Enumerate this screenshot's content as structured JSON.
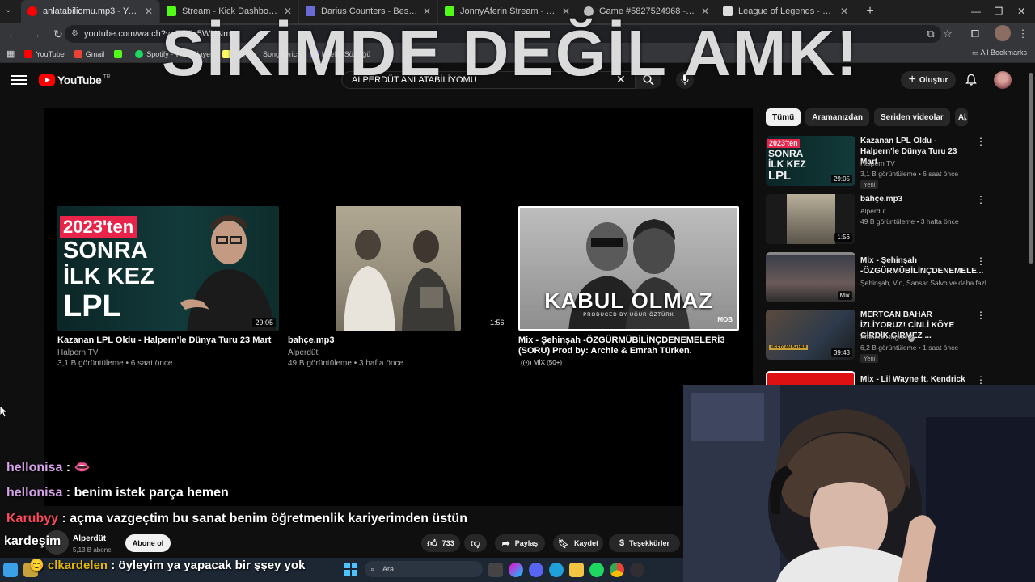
{
  "tabs": [
    {
      "title": "anlatabiliomu.mp3 - YouTube",
      "color": "#ff0000",
      "active": true
    },
    {
      "title": "Stream - Kick Dashboard",
      "color": "#53fc18",
      "active": false
    },
    {
      "title": "Darius Counters - Best & Worst",
      "color": "#6b6bd6",
      "active": false
    },
    {
      "title": "JonnyAferin Stream - Watch Live",
      "color": "#53fc18",
      "active": false
    },
    {
      "title": "Game #5827524968 - Mineswe",
      "color": "#bbbbbb",
      "active": false
    },
    {
      "title": "League of Legends - Speedrun",
      "color": "#dddddd",
      "active": false
    }
  ],
  "address": {
    "url": "youtube.com/watch?v=BGIiv5WUNmg"
  },
  "bookmarks": [
    {
      "label": "YouTube",
      "color": "#ff0000"
    },
    {
      "label": "Gmail",
      "color": "#ea4335"
    },
    {
      "label": "",
      "color": "#53fc18"
    },
    {
      "label": "Spotify - Web Player",
      "color": "#1ed760"
    },
    {
      "label": "Genius | Song Lyrics",
      "color": "#ffff64"
    },
    {
      "label": "Hileler Sözlüğü",
      "color": "#7b68ee"
    }
  ],
  "all_bookmarks": "All Bookmarks",
  "youtube": {
    "logo": "YouTube",
    "region": "TR",
    "search_value": "ALPERDÜT ANLATABİLİYOMU",
    "create": "Oluştur"
  },
  "overlay": "SİKİMDE DEĞİL AMK!",
  "endcards": [
    {
      "title": "Kazanan LPL Oldu - Halpern'le Dünya Turu 23 Mart",
      "channel": "Halpern TV",
      "meta": "3,1 B görüntüleme • 6 saat önce",
      "duration": "29:05",
      "thumb_lines": [
        "2023'ten",
        "SONRA",
        "İLK KEZ",
        "LPL"
      ]
    },
    {
      "title": "bahçe.mp3",
      "channel": "Alperdüt",
      "meta": "49 B görüntüleme • 3 hafta önce",
      "duration": "1:56"
    },
    {
      "title": "Mix - Şehinşah -ÖZGÜRMÜBİLİNÇDENEMELERİ3 (SORU) Prod by: Archie & Emrah Türken.",
      "channel": "MİX (50+)",
      "thumb_text": "KABUL OLMAZ",
      "thumb_sub": "PRODUCED BY UĞUR ÖZTÜRK",
      "thumb_logo": "MOB"
    }
  ],
  "chips": [
    "Tümü",
    "Aramanızdan",
    "Seriden videolar",
    "Al"
  ],
  "sidebar": [
    {
      "title": "Kazanan LPL Oldu - Halpern'le Dünya Turu 23 Mart",
      "channel": "Halpern TV",
      "meta": "3,1 B görüntüleme • 6 saat önce",
      "badge": "Yeni",
      "duration": "29:05"
    },
    {
      "title": "bahçe.mp3",
      "channel": "Alperdüt",
      "meta": "49 B görüntüleme • 3 hafta önce",
      "duration": "1:56"
    },
    {
      "title": "Mix - Şehinşah -ÖZGÜRMÜBİLİNÇDENEMELE...",
      "channel": "Şehinşah, Vio, Sansar Salvo ve daha fazl...",
      "duration": "Mix"
    },
    {
      "title": "MERTCAN BAHAR İZLİYORUZ! CİNLİ KÖYE GİRDİK GİRMEZ ...",
      "channel": "Ataberk Doğan",
      "meta": "6,2 B görüntüleme • 1 saat önce",
      "badge": "Yeni",
      "duration": "39:43"
    },
    {
      "title": "Mix - Lil Wayne ft. Kendrick"
    }
  ],
  "chat": [
    {
      "user": "hellonisa",
      "sep": " : ",
      "message": "👄"
    },
    {
      "user": "hellonisa",
      "sep": " : ",
      "message": "benim istek parça hemen"
    },
    {
      "user": "Karubyy",
      "sep": " : ",
      "message": "açma vazgeçtim bu sanat benim öğretmenlik kariyerimden üstün"
    },
    {
      "user": "",
      "sep": "",
      "message": "kardeşim"
    },
    {
      "user": "clkardelen",
      "sep": " : ",
      "message": "öyleyim ya yapacak bir şşey yok"
    }
  ],
  "video_bar": {
    "channel": "Alperdüt",
    "subs": "5,13 B abone",
    "subscribe": "Abone ol",
    "likes": "733",
    "share": "Paylaş",
    "save": "Kaydet",
    "thanks": "Teşekkürler"
  },
  "taskbar": {
    "search_placeholder": "Ara"
  }
}
